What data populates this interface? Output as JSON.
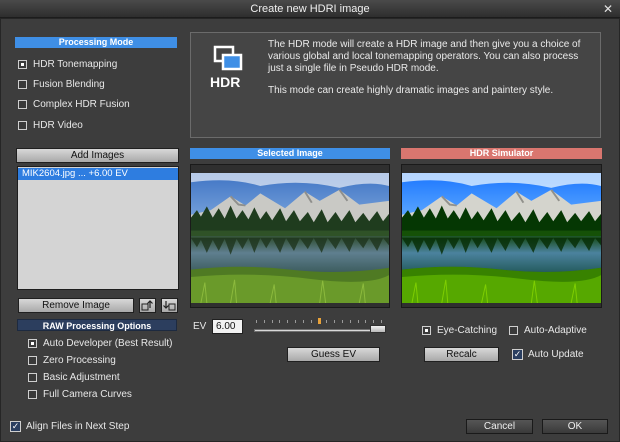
{
  "window": {
    "title": "Create new HDRI image",
    "close_glyph": "✕"
  },
  "processing_mode": {
    "header": "Processing  Mode",
    "options": [
      {
        "label": "HDR Tonemapping",
        "selected": true
      },
      {
        "label": "Fusion Blending",
        "selected": false
      },
      {
        "label": "Complex HDR Fusion",
        "selected": false
      },
      {
        "label": "HDR Video",
        "selected": false
      }
    ]
  },
  "info": {
    "logo_text": "HDR",
    "paragraph1": "The HDR mode will create a HDR image and then give you a choice of various global and local tonemapping operators. You can also process just a single file in Pseudo HDR mode.",
    "paragraph2": "This mode can create highly dramatic images and paintery style."
  },
  "images": {
    "add_label": "Add Images",
    "items": [
      "MIK2604.jpg ... +6.00 EV"
    ],
    "remove_label": "Remove Image"
  },
  "raw_options": {
    "header": "RAW Processing Options",
    "options": [
      {
        "label": "Auto Developer (Best Result)",
        "selected": true
      },
      {
        "label": "Zero Processing",
        "selected": false
      },
      {
        "label": "Basic Adjustment",
        "selected": false
      },
      {
        "label": "Full Camera Curves",
        "selected": false
      }
    ]
  },
  "selected_image": {
    "header": "Selected Image",
    "ev_label": "EV",
    "ev_value": "6.00",
    "guess_label": "Guess EV"
  },
  "simulator": {
    "header": "HDR Simulator",
    "eye_catching": "Eye-Catching",
    "auto_adaptive": "Auto-Adaptive",
    "recalc": "Recalc",
    "auto_update": "Auto Update",
    "auto_update_checked": true
  },
  "footer": {
    "align_label": "Align Files in Next Step",
    "align_checked": true,
    "cancel": "Cancel",
    "ok": "OK"
  },
  "colors": {
    "accent_blue": "#3f8fe6",
    "simulator_red": "#d9766f",
    "list_select": "#2e7de0"
  }
}
